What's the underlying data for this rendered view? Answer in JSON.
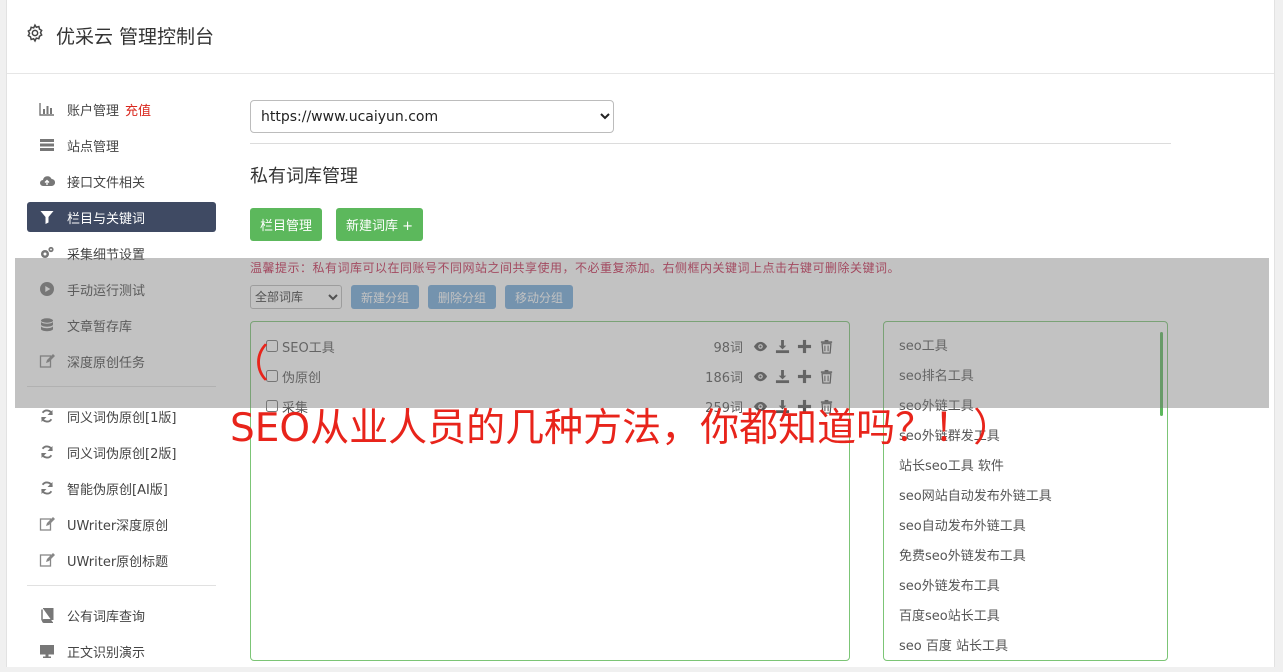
{
  "app": {
    "title": "优采云 管理控制台"
  },
  "sidebar": {
    "items": [
      {
        "label": "账户管理",
        "icon": "bar-chart-icon",
        "badge": "充值",
        "active": false
      },
      {
        "label": "站点管理",
        "icon": "server-icon",
        "active": false
      },
      {
        "label": "接口文件相关",
        "icon": "cloud-upload-icon",
        "active": false
      },
      {
        "label": "栏目与关键词",
        "icon": "filter-icon",
        "active": true
      },
      {
        "label": "采集细节设置",
        "icon": "cogs-icon",
        "active": false
      },
      {
        "label": "手动运行测试",
        "icon": "play-circle-icon",
        "active": false
      },
      {
        "label": "文章暂存库",
        "icon": "database-icon",
        "active": false
      },
      {
        "label": "深度原创任务",
        "icon": "edit-icon",
        "active": false
      }
    ],
    "items2": [
      {
        "label": "同义词伪原创[1版]",
        "icon": "refresh-icon"
      },
      {
        "label": "同义词伪原创[2版]",
        "icon": "refresh-icon"
      },
      {
        "label": "智能伪原创[AI版]",
        "icon": "refresh-icon"
      },
      {
        "label": "UWriter深度原创",
        "icon": "edit-icon"
      },
      {
        "label": "UWriter原创标题",
        "icon": "edit-icon"
      }
    ],
    "items3": [
      {
        "label": "公有词库查询",
        "icon": "book-icon"
      },
      {
        "label": "正文识别演示",
        "icon": "monitor-icon"
      }
    ]
  },
  "main": {
    "site_select": {
      "value": "https://www.ucaiyun.com"
    },
    "section_title": "私有词库管理",
    "buttons": {
      "category": "栏目管理",
      "new_lib": "新建词库 +"
    },
    "tip": "温馨提示：私有词库可以在同账号不同网站之间共享使用，不必重复添加。右侧框内关键词上点击右键可删除关键词。",
    "group_select": {
      "value": "全部词库"
    },
    "group_buttons": {
      "new": "新建分组",
      "delete": "删除分组",
      "move": "移动分组"
    },
    "libraries": [
      {
        "name": "SEO工具",
        "count": "98词"
      },
      {
        "name": "伪原创",
        "count": "186词"
      },
      {
        "name": "采集",
        "count": "259词"
      }
    ],
    "keywords": [
      "seo工具",
      "seo排名工具",
      "seo外链工具",
      "seo外链群发工具",
      "站长seo工具 软件",
      "seo网站自动发布外链工具",
      "seo自动发布外链工具",
      "免费seo外链发布工具",
      "seo外链发布工具",
      "百度seo站长工具",
      "seo 百度 站长工具"
    ]
  },
  "overlay": {
    "line1": "（",
    "line2": "SEO从业人员的几种方法，你都知道吗？！）"
  },
  "colors": {
    "accent_green": "#5cb85c",
    "active_nav": "#3f4a63",
    "badge_red": "#d9261c",
    "overlay_red": "#e8241b"
  }
}
